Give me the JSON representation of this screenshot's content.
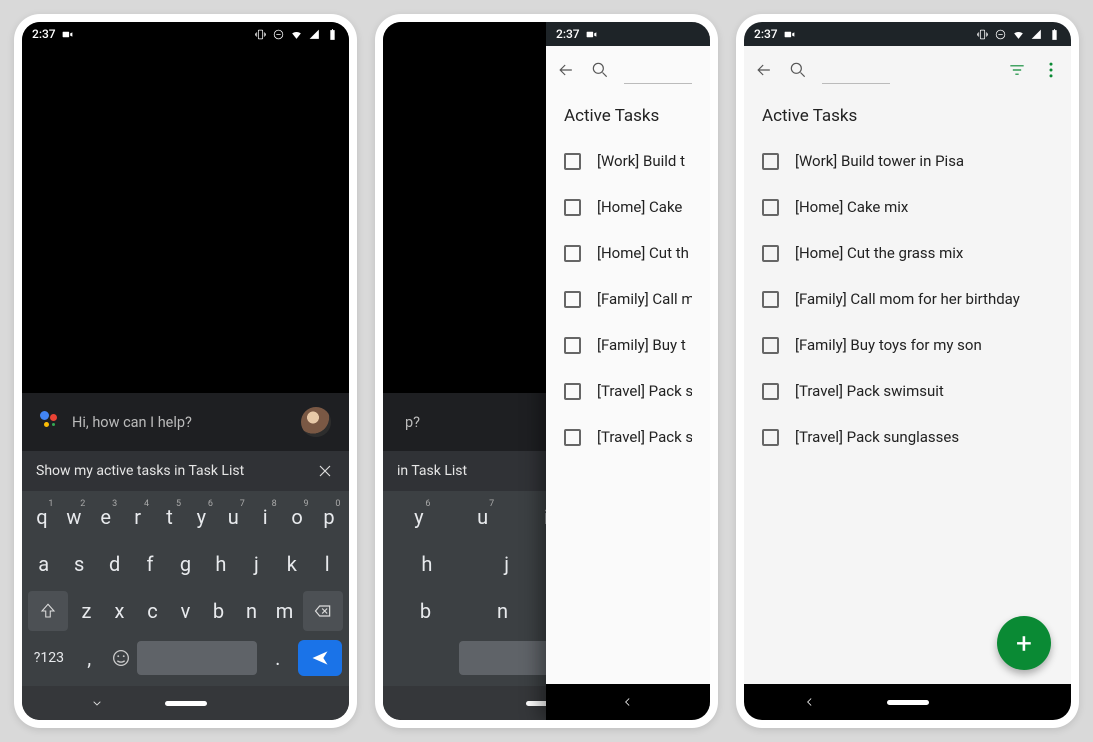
{
  "status": {
    "time": "2:37"
  },
  "assistant": {
    "prompt": "Hi, how can I help?",
    "suggestion": "Show my active tasks in Task List",
    "suggestion_partial_mid": "in Task List",
    "suggestion_partial_p2_visible": "p?"
  },
  "keyboard": {
    "row1": [
      "q",
      "w",
      "e",
      "r",
      "t",
      "y",
      "u",
      "i",
      "o",
      "p"
    ],
    "row1sup": [
      "1",
      "2",
      "3",
      "4",
      "5",
      "6",
      "7",
      "8",
      "9",
      "0"
    ],
    "row2": [
      "a",
      "s",
      "d",
      "f",
      "g",
      "h",
      "j",
      "k",
      "l"
    ],
    "row3": [
      "z",
      "x",
      "c",
      "v",
      "b",
      "n",
      "m"
    ],
    "sym": "?123",
    "comma": ",",
    "period": "."
  },
  "tasks": {
    "section_title": "Active Tasks",
    "items": [
      "[Work] Build tower in Pisa",
      "[Home] Cake mix",
      "[Home] Cut the grass mix",
      "[Family] Call mom for her birthday",
      "[Family] Buy toys for my son",
      "[Travel] Pack swimsuit",
      "[Travel] Pack sunglasses"
    ],
    "items_truncated_mid": [
      "[Work] Build t",
      "[Home] Cake",
      "[Home] Cut th",
      "[Family] Call m",
      "[Family] Buy t",
      "[Travel] Pack s",
      "[Travel] Pack s"
    ]
  }
}
